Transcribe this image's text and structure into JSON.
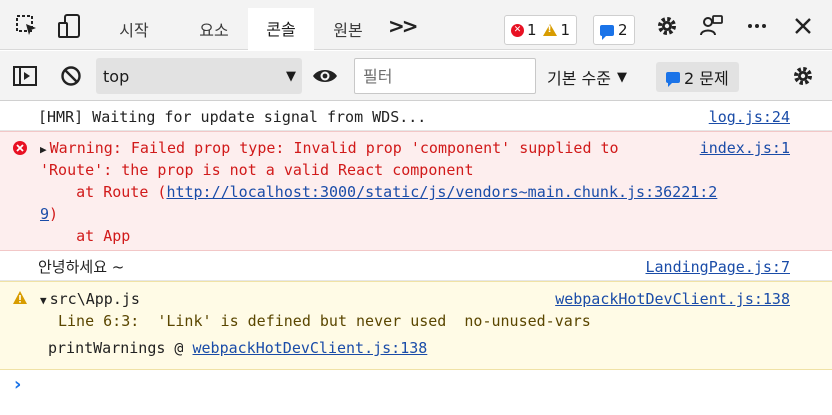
{
  "tabs": [
    {
      "label": "시작"
    },
    {
      "label": "요소"
    },
    {
      "label": "콘솔"
    },
    {
      "label": "원본"
    }
  ],
  "badges": {
    "errors": "1",
    "warnings": "1",
    "messages": "2"
  },
  "toolbar": {
    "context": "top",
    "filter_placeholder": "필터",
    "levels": "기본 수준",
    "issues": "2 문제"
  },
  "console": {
    "hmr": {
      "text": "[HMR] Waiting for update signal from WDS...",
      "source": "log.js:24"
    },
    "error": {
      "line1": "Warning: Failed prop type: Invalid prop 'component' supplied to",
      "line2": "'Route': the prop is not a valid React component",
      "line3_prefix": "    at Route (",
      "line3_link": "http://localhost:3000/static/js/vendors~main.chunk.js:36221:2",
      "line4_link": "9",
      "line4_suffix": ")",
      "line5": "    at App",
      "source": "index.js:1"
    },
    "greeting": {
      "text": "안녕하세요 ~",
      "source": "LandingPage.js:7"
    },
    "warning": {
      "file": "src\\App.js",
      "detail": "Line 6:3:  'Link' is defined but never used  no-unused-vars",
      "trace_prefix": "printWarnings @ ",
      "trace_link": "webpackHotDevClient.js:138",
      "source": "webpackHotDevClient.js:138"
    }
  },
  "colors": {
    "error": "#d11a1a",
    "warning": "#d89c00",
    "link": "#1a4ca8",
    "accent": "#1a73e8"
  }
}
